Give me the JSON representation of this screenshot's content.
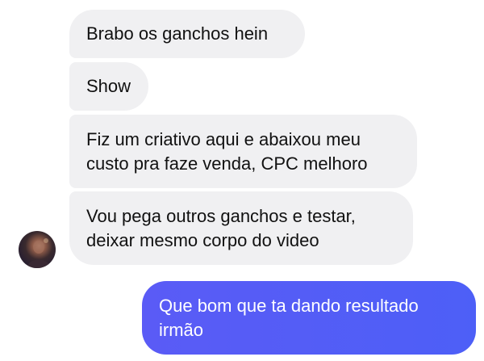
{
  "messages": [
    {
      "direction": "incoming",
      "text": "Brabo os ganchos hein"
    },
    {
      "direction": "incoming",
      "text": "Show"
    },
    {
      "direction": "incoming",
      "text_lines": [
        "Fiz um criativo aqui e abaixou meu",
        "custo pra faze venda, CPC melhoro"
      ]
    },
    {
      "direction": "incoming",
      "text_lines": [
        "Vou pega outros ganchos e testar,",
        "deixar mesmo corpo do video"
      ]
    },
    {
      "direction": "outgoing",
      "text_lines": [
        "Que bom que ta dando resultado",
        "irmão"
      ]
    }
  ],
  "contact": {
    "avatar_icon": "user-avatar"
  },
  "colors": {
    "incoming_bubble": "#f0f0f2",
    "outgoing_bubble": "#4e5dff",
    "incoming_text": "#111111",
    "outgoing_text": "#ffffff"
  }
}
